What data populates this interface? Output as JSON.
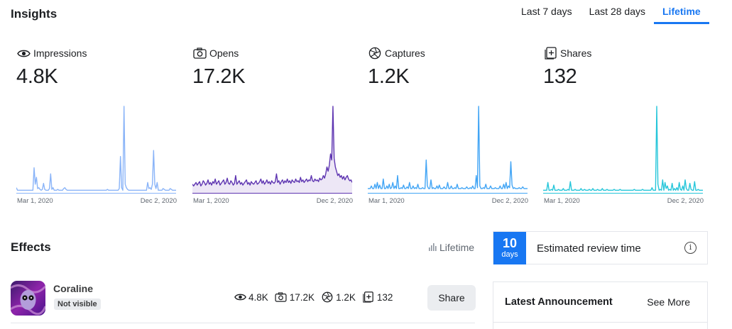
{
  "insights": {
    "title": "Insights",
    "tabs": [
      {
        "label": "Last 7 days",
        "active": false
      },
      {
        "label": "Last 28 days",
        "active": false
      },
      {
        "label": "Lifetime",
        "active": true
      }
    ]
  },
  "metrics": [
    {
      "label": "Impressions",
      "value": "4.8K",
      "icon": "eye-icon",
      "color": "#8ab4f8",
      "fill": false
    },
    {
      "label": "Opens",
      "value": "17.2K",
      "icon": "camera-icon",
      "color": "#5e35b1",
      "fill": true
    },
    {
      "label": "Captures",
      "value": "1.2K",
      "icon": "aperture-icon",
      "color": "#42a5f5",
      "fill": false
    },
    {
      "label": "Shares",
      "value": "132",
      "icon": "share-plus-icon",
      "color": "#26c6da",
      "fill": false
    }
  ],
  "axis": {
    "start": "Mar 1, 2020",
    "end": "Dec 2, 2020"
  },
  "chart_data": [
    {
      "type": "line",
      "series": [
        {
          "values": [
            0.06,
            0.03,
            0.03,
            0.03,
            0.03,
            0.03,
            0.03,
            0.03,
            0.03,
            0.03,
            0.03,
            0.03,
            0.03,
            0.03,
            0.03,
            0.29,
            0.1,
            0.18,
            0.05,
            0.06,
            0.04,
            0.03,
            0.04,
            0.11,
            0.04,
            0.03,
            0.03,
            0.03,
            0.05,
            0.22,
            0.04,
            0.06,
            0.03,
            0.03,
            0.03,
            0.04,
            0.03,
            0.03,
            0.03,
            0.03,
            0.05,
            0.06,
            0.04,
            0.03,
            0.03,
            0.03,
            0.03,
            0.03,
            0.03,
            0.03,
            0.03,
            0.03,
            0.03,
            0.03,
            0.03,
            0.03,
            0.03,
            0.03,
            0.03,
            0.03,
            0.03,
            0.03,
            0.03,
            0.03,
            0.03,
            0.03,
            0.03,
            0.03,
            0.03,
            0.03,
            0.03,
            0.03,
            0.03,
            0.03,
            0.03,
            0.03,
            0.03,
            0.04,
            0.03,
            0.03,
            0.03,
            0.03,
            0.03,
            0.03,
            0.03,
            0.03,
            0.03,
            0.05,
            0.42,
            0.06,
            0.03,
            1.0,
            0.1,
            0.06,
            0.04,
            0.03,
            0.03,
            0.03,
            0.03,
            0.03,
            0.03,
            0.03,
            0.03,
            0.03,
            0.03,
            0.03,
            0.03,
            0.03,
            0.03,
            0.03,
            0.03,
            0.12,
            0.05,
            0.06,
            0.04,
            0.1,
            0.49,
            0.1,
            0.05,
            0.12,
            0.03,
            0.03,
            0.03,
            0.03,
            0.05,
            0.04,
            0.03,
            0.03,
            0.03,
            0.03,
            0.05,
            0.04,
            0.03,
            0.03,
            0.03,
            0.03
          ]
        }
      ]
    },
    {
      "type": "area",
      "series": [
        {
          "values": [
            0.1,
            0.08,
            0.1,
            0.12,
            0.09,
            0.11,
            0.13,
            0.08,
            0.1,
            0.14,
            0.12,
            0.09,
            0.11,
            0.15,
            0.1,
            0.12,
            0.09,
            0.13,
            0.11,
            0.16,
            0.1,
            0.12,
            0.14,
            0.09,
            0.11,
            0.13,
            0.15,
            0.1,
            0.12,
            0.17,
            0.11,
            0.1,
            0.14,
            0.12,
            0.09,
            0.11,
            0.2,
            0.1,
            0.12,
            0.14,
            0.1,
            0.12,
            0.09,
            0.11,
            0.13,
            0.15,
            0.1,
            0.12,
            0.09,
            0.13,
            0.11,
            0.1,
            0.12,
            0.14,
            0.1,
            0.11,
            0.13,
            0.16,
            0.11,
            0.14,
            0.1,
            0.12,
            0.15,
            0.11,
            0.13,
            0.1,
            0.14,
            0.12,
            0.11,
            0.13,
            0.22,
            0.12,
            0.14,
            0.1,
            0.13,
            0.15,
            0.11,
            0.14,
            0.12,
            0.16,
            0.12,
            0.14,
            0.11,
            0.15,
            0.13,
            0.12,
            0.16,
            0.13,
            0.14,
            0.12,
            0.18,
            0.13,
            0.15,
            0.12,
            0.14,
            0.16,
            0.13,
            0.15,
            0.14,
            0.2,
            0.14,
            0.13,
            0.16,
            0.14,
            0.15,
            0.13,
            0.17,
            0.15,
            0.16,
            0.2,
            0.17,
            0.22,
            0.3,
            0.25,
            0.32,
            0.45,
            0.38,
            1.0,
            0.4,
            0.3,
            0.25,
            0.2,
            0.22,
            0.18,
            0.2,
            0.16,
            0.19,
            0.15,
            0.18,
            0.2,
            0.16,
            0.14,
            0.15,
            0.12
          ]
        }
      ]
    },
    {
      "type": "line",
      "series": [
        {
          "values": [
            0.05,
            0.05,
            0.05,
            0.08,
            0.05,
            0.05,
            0.1,
            0.05,
            0.12,
            0.05,
            0.09,
            0.05,
            0.05,
            0.16,
            0.05,
            0.05,
            0.08,
            0.05,
            0.1,
            0.05,
            0.06,
            0.12,
            0.05,
            0.08,
            0.05,
            0.2,
            0.05,
            0.05,
            0.06,
            0.05,
            0.09,
            0.05,
            0.05,
            0.07,
            0.05,
            0.12,
            0.05,
            0.05,
            0.08,
            0.05,
            0.06,
            0.05,
            0.1,
            0.05,
            0.05,
            0.05,
            0.06,
            0.05,
            0.05,
            0.38,
            0.08,
            0.05,
            0.05,
            0.15,
            0.05,
            0.06,
            0.05,
            0.05,
            0.08,
            0.05,
            0.09,
            0.05,
            0.05,
            0.05,
            0.07,
            0.05,
            0.05,
            0.12,
            0.05,
            0.05,
            0.08,
            0.05,
            0.05,
            0.06,
            0.05,
            0.1,
            0.05,
            0.05,
            0.05,
            0.06,
            0.05,
            0.05,
            0.05,
            0.07,
            0.05,
            0.05,
            0.06,
            0.05,
            0.08,
            0.05,
            0.05,
            0.2,
            0.06,
            1.0,
            0.08,
            0.05,
            0.05,
            0.06,
            0.05,
            0.1,
            0.05,
            0.05,
            0.05,
            0.08,
            0.05,
            0.05,
            0.05,
            0.06,
            0.05,
            0.05,
            0.05,
            0.08,
            0.05,
            0.05,
            0.1,
            0.05,
            0.12,
            0.05,
            0.08,
            0.06,
            0.36,
            0.09,
            0.05,
            0.06,
            0.05,
            0.05,
            0.05,
            0.06,
            0.05,
            0.05,
            0.07,
            0.05,
            0.05,
            0.05,
            0.05
          ]
        }
      ]
    },
    {
      "type": "line",
      "series": [
        {
          "values": [
            0.03,
            0.03,
            0.03,
            0.03,
            0.12,
            0.03,
            0.03,
            0.04,
            0.03,
            0.09,
            0.03,
            0.03,
            0.03,
            0.04,
            0.03,
            0.03,
            0.03,
            0.05,
            0.03,
            0.03,
            0.03,
            0.04,
            0.03,
            0.13,
            0.03,
            0.03,
            0.03,
            0.04,
            0.03,
            0.03,
            0.03,
            0.03,
            0.05,
            0.03,
            0.03,
            0.04,
            0.03,
            0.03,
            0.03,
            0.04,
            0.03,
            0.03,
            0.05,
            0.03,
            0.03,
            0.03,
            0.04,
            0.03,
            0.03,
            0.03,
            0.05,
            0.03,
            0.03,
            0.03,
            0.04,
            0.03,
            0.03,
            0.03,
            0.03,
            0.03,
            0.04,
            0.03,
            0.03,
            0.03,
            0.03,
            0.04,
            0.03,
            0.03,
            0.03,
            0.03,
            0.03,
            0.03,
            0.03,
            0.03,
            0.03,
            0.03,
            0.03,
            0.04,
            0.03,
            0.03,
            0.03,
            0.03,
            0.03,
            0.03,
            0.04,
            0.03,
            0.03,
            0.03,
            0.03,
            0.03,
            0.03,
            0.03,
            0.06,
            0.03,
            0.03,
            0.03,
            1.0,
            0.1,
            0.03,
            0.04,
            0.03,
            0.15,
            0.03,
            0.12,
            0.05,
            0.08,
            0.03,
            0.04,
            0.03,
            0.11,
            0.03,
            0.05,
            0.03,
            0.06,
            0.03,
            0.12,
            0.04,
            0.03,
            0.08,
            0.03,
            0.15,
            0.05,
            0.03,
            0.03,
            0.11,
            0.04,
            0.03,
            0.03,
            0.13,
            0.03,
            0.03,
            0.04,
            0.03,
            0.03,
            0.03,
            0.03
          ]
        }
      ]
    }
  ],
  "effects": {
    "title": "Effects",
    "range_label": "Lifetime",
    "item": {
      "name": "Coraline",
      "status": "Not visible",
      "stats": [
        {
          "icon": "eye-icon",
          "value": "4.8K"
        },
        {
          "icon": "camera-icon",
          "value": "17.2K"
        },
        {
          "icon": "aperture-icon",
          "value": "1.2K"
        },
        {
          "icon": "share-plus-icon",
          "value": "132"
        }
      ],
      "share_label": "Share"
    }
  },
  "review": {
    "days": "10",
    "unit": "days",
    "label": "Estimated review time",
    "info": "i"
  },
  "announcement": {
    "title": "Latest Announcement",
    "more": "See More"
  }
}
